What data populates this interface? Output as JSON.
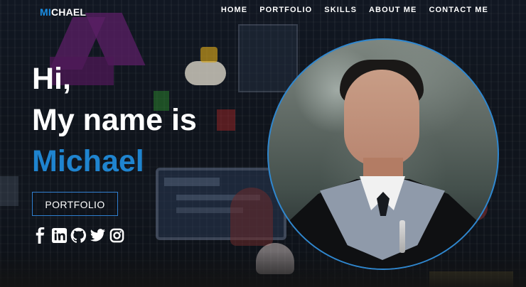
{
  "brand": {
    "accent": "MI",
    "rest": "CHAEL"
  },
  "nav": {
    "items": [
      "HOME",
      "PORTFOLIO",
      "SKILLS",
      "ABOUT ME",
      "CONTACT ME"
    ]
  },
  "hero": {
    "greeting": "Hi,",
    "intro": "My name is",
    "name": "Michael",
    "button_label": "PORTFOLIO"
  },
  "social": {
    "icons": [
      "facebook-icon",
      "linkedin-icon",
      "github-icon",
      "twitter-icon",
      "instagram-icon"
    ]
  },
  "colors": {
    "accent": "#1f84cf",
    "text": "#ffffff",
    "ring": "#2f87cf"
  }
}
